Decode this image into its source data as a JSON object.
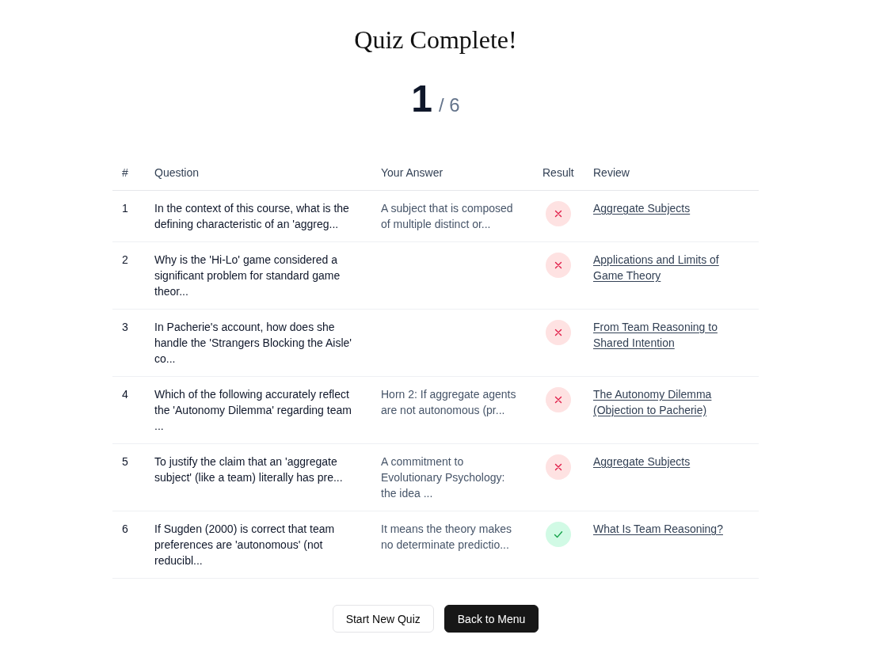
{
  "title": "Quiz Complete!",
  "score": {
    "value": "1",
    "total": "/ 6"
  },
  "table": {
    "columns": [
      "#",
      "Question",
      "Your Answer",
      "Result",
      "Review"
    ],
    "rows": [
      {
        "number": "1",
        "question": "In the context of this course, what is the defining characteristic of an 'aggreg...",
        "answer": "A subject that is composed of multiple distinct or...",
        "correct": false,
        "review": "Aggregate Subjects"
      },
      {
        "number": "2",
        "question": "Why is the 'Hi-Lo' game considered a significant problem for standard game theor...",
        "correct": false,
        "review": "Applications and Limits of Game Theory"
      },
      {
        "number": "3",
        "question": "In Pacherie's account, how does she handle the 'Strangers Blocking the Aisle' co...",
        "correct": false,
        "review": "From Team Reasoning to Shared Intention"
      },
      {
        "number": "4",
        "question": "Which of the following accurately reflect the 'Autonomy Dilemma' regarding team ...",
        "answer": "Horn 2: If aggregate agents are not autonomous (pr...",
        "correct": false,
        "review": "The Autonomy Dilemma (Objection to Pacherie)"
      },
      {
        "number": "5",
        "question": "To justify the claim that an 'aggregate subject' (like a team) literally has pre...",
        "answer": "A commitment to Evolutionary Psychology: the idea ...",
        "correct": false,
        "review": "Aggregate Subjects"
      },
      {
        "number": "6",
        "question": "If Sugden (2000) is correct that team preferences are 'autonomous' (not reducibl...",
        "answer": "It means the theory makes no determinate predictio...",
        "correct": true,
        "review": "What Is Team Reasoning?"
      }
    ]
  },
  "buttons": [
    {
      "label": "Start New Quiz",
      "kind": "secondary"
    },
    {
      "label": "Back to Menu",
      "kind": "primary"
    }
  ]
}
